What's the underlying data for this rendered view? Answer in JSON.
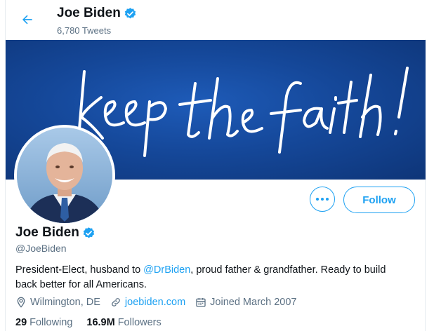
{
  "header": {
    "back_icon": "arrow-left-icon",
    "name": "Joe Biden",
    "tweet_count": "6,780 Tweets",
    "verified_icon": "verified-badge-icon"
  },
  "banner": {
    "text": "keep the faith!",
    "colors": {
      "dark": "#0e3578",
      "mid": "#15489a",
      "light": "#1e5bb8"
    }
  },
  "actions": {
    "more_icon": "more-options-icon",
    "follow_label": "Follow"
  },
  "profile": {
    "name": "Joe Biden",
    "handle": "@JoeBiden",
    "bio_before": "President-Elect, husband to ",
    "bio_mention": "@DrBiden",
    "bio_after": ", proud father & grandfather. Ready to build back better for all Americans.",
    "location": "Wilmington, DE",
    "website": "joebiden.com",
    "joined": "Joined March 2007",
    "following_count": "29",
    "following_label": "Following",
    "followers_count": "16.9M",
    "followers_label": "Followers"
  },
  "colors": {
    "accent": "#1da1f2",
    "muted": "#5b7083",
    "text": "#0f1419"
  }
}
